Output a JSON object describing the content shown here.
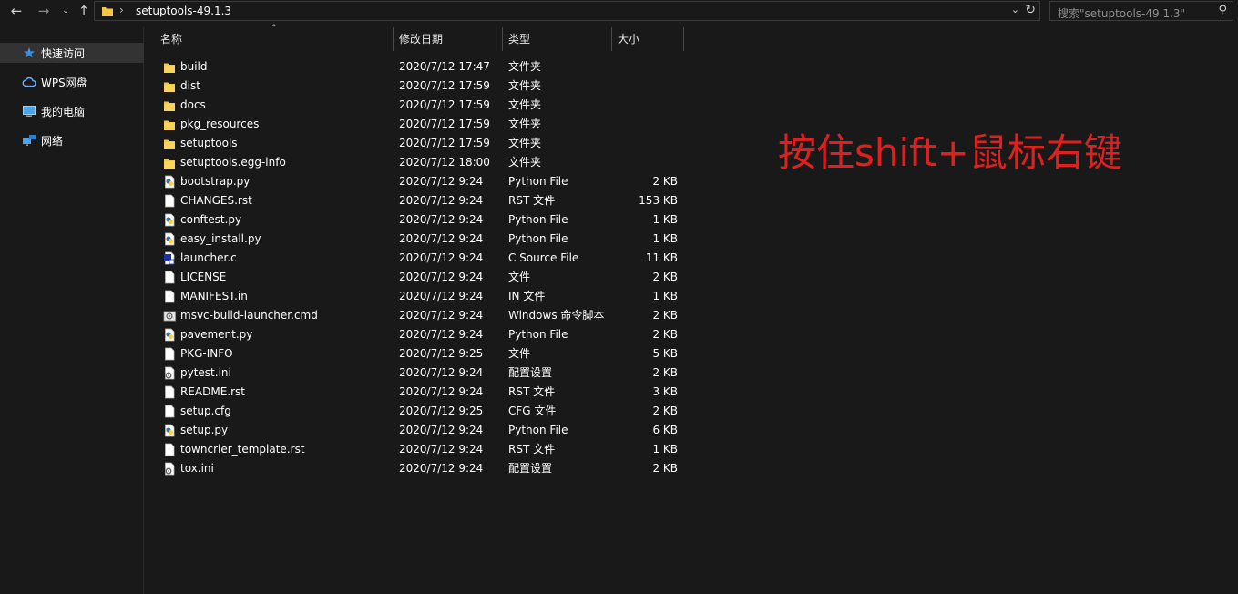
{
  "nav": {
    "back": "←",
    "forward": "→",
    "recent": "⌄",
    "up": "↑"
  },
  "address": {
    "separator": "›",
    "path": "setuptools-49.1.3",
    "dropdown": "⌄",
    "refresh": "↻"
  },
  "search": {
    "placeholder": "搜索\"setuptools-49.1.3\"",
    "icon": "⚲"
  },
  "sidebar": {
    "items": [
      {
        "label": "快速访问",
        "icon": "star-icon"
      },
      {
        "label": "WPS网盘",
        "icon": "cloud-icon"
      },
      {
        "label": "我的电脑",
        "icon": "computer-icon"
      },
      {
        "label": "网络",
        "icon": "network-icon"
      }
    ]
  },
  "columns": {
    "name": "名称",
    "date": "修改日期",
    "type": "类型",
    "size": "大小",
    "sort_indicator": "^"
  },
  "files": [
    {
      "name": "build",
      "date": "2020/7/12 17:47",
      "type": "文件夹",
      "size": "",
      "icon": "folder-icon"
    },
    {
      "name": "dist",
      "date": "2020/7/12 17:59",
      "type": "文件夹",
      "size": "",
      "icon": "folder-icon"
    },
    {
      "name": "docs",
      "date": "2020/7/12 17:59",
      "type": "文件夹",
      "size": "",
      "icon": "folder-icon"
    },
    {
      "name": "pkg_resources",
      "date": "2020/7/12 17:59",
      "type": "文件夹",
      "size": "",
      "icon": "folder-icon"
    },
    {
      "name": "setuptools",
      "date": "2020/7/12 17:59",
      "type": "文件夹",
      "size": "",
      "icon": "folder-icon"
    },
    {
      "name": "setuptools.egg-info",
      "date": "2020/7/12 18:00",
      "type": "文件夹",
      "size": "",
      "icon": "folder-icon"
    },
    {
      "name": "bootstrap.py",
      "date": "2020/7/12 9:24",
      "type": "Python File",
      "size": "2 KB",
      "icon": "python-file-icon"
    },
    {
      "name": "CHANGES.rst",
      "date": "2020/7/12 9:24",
      "type": "RST 文件",
      "size": "153 KB",
      "icon": "file-icon"
    },
    {
      "name": "conftest.py",
      "date": "2020/7/12 9:24",
      "type": "Python File",
      "size": "1 KB",
      "icon": "python-file-icon"
    },
    {
      "name": "easy_install.py",
      "date": "2020/7/12 9:24",
      "type": "Python File",
      "size": "1 KB",
      "icon": "python-file-icon"
    },
    {
      "name": "launcher.c",
      "date": "2020/7/12 9:24",
      "type": "C Source File",
      "size": "11 KB",
      "icon": "c-file-icon"
    },
    {
      "name": "LICENSE",
      "date": "2020/7/12 9:24",
      "type": "文件",
      "size": "2 KB",
      "icon": "file-icon"
    },
    {
      "name": "MANIFEST.in",
      "date": "2020/7/12 9:24",
      "type": "IN 文件",
      "size": "1 KB",
      "icon": "file-icon"
    },
    {
      "name": "msvc-build-launcher.cmd",
      "date": "2020/7/12 9:24",
      "type": "Windows 命令脚本",
      "size": "2 KB",
      "icon": "cmd-file-icon"
    },
    {
      "name": "pavement.py",
      "date": "2020/7/12 9:24",
      "type": "Python File",
      "size": "2 KB",
      "icon": "python-file-icon"
    },
    {
      "name": "PKG-INFO",
      "date": "2020/7/12 9:25",
      "type": "文件",
      "size": "5 KB",
      "icon": "file-icon"
    },
    {
      "name": "pytest.ini",
      "date": "2020/7/12 9:24",
      "type": "配置设置",
      "size": "2 KB",
      "icon": "settings-file-icon"
    },
    {
      "name": "README.rst",
      "date": "2020/7/12 9:24",
      "type": "RST 文件",
      "size": "3 KB",
      "icon": "file-icon"
    },
    {
      "name": "setup.cfg",
      "date": "2020/7/12 9:25",
      "type": "CFG 文件",
      "size": "2 KB",
      "icon": "file-icon"
    },
    {
      "name": "setup.py",
      "date": "2020/7/12 9:24",
      "type": "Python File",
      "size": "6 KB",
      "icon": "python-file-icon"
    },
    {
      "name": "towncrier_template.rst",
      "date": "2020/7/12 9:24",
      "type": "RST 文件",
      "size": "1 KB",
      "icon": "file-icon"
    },
    {
      "name": "tox.ini",
      "date": "2020/7/12 9:24",
      "type": "配置设置",
      "size": "2 KB",
      "icon": "settings-file-icon"
    }
  ],
  "annotation": "按住shift+鼠标右键",
  "colors": {
    "background": "#191919",
    "annotation": "#e02020",
    "folder": "#f5c842"
  }
}
